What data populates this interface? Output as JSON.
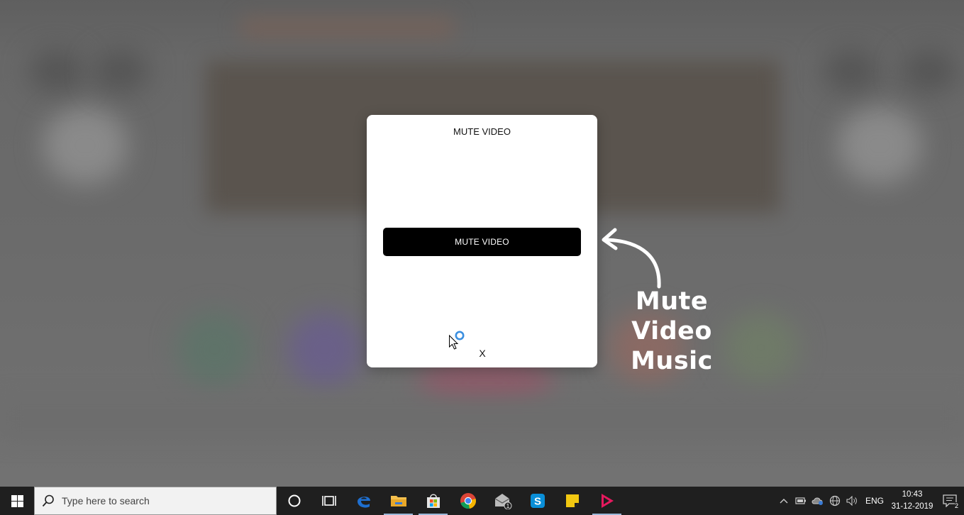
{
  "dialog": {
    "title": "MUTE VIDEO",
    "button_label": "MUTE VIDEO",
    "close_label": "X"
  },
  "annotation": {
    "line1": "Mute Video",
    "line2": "Music"
  },
  "taskbar": {
    "search_placeholder": "Type here to search",
    "apps": [
      {
        "name": "cortana",
        "icon": "circle-icon"
      },
      {
        "name": "task-view",
        "icon": "task-view-icon"
      },
      {
        "name": "edge",
        "icon": "edge-icon"
      },
      {
        "name": "file-explorer",
        "icon": "folder-icon"
      },
      {
        "name": "store",
        "icon": "store-bag-icon"
      },
      {
        "name": "chrome",
        "icon": "chrome-icon"
      },
      {
        "name": "mail",
        "icon": "mail-icon",
        "badge": "1"
      },
      {
        "name": "skype",
        "icon": "skype-icon"
      },
      {
        "name": "sticky-notes",
        "icon": "sticky-note-icon"
      },
      {
        "name": "video-app",
        "icon": "play-icon"
      }
    ],
    "tray": {
      "language": "ENG",
      "time": "10:43",
      "date": "31-12-2019",
      "notification_count": "2"
    }
  },
  "colors": {
    "dialog_bg": "#ffffff",
    "button_bg": "#000000",
    "taskbar_bg": "#1f1f1f",
    "overlay": "#6b6b6b",
    "edge_blue": "#1e6fd0",
    "skype_blue": "#0a8fd8",
    "sticky_yellow": "#f2c811",
    "video_pink": "#e6195e"
  }
}
